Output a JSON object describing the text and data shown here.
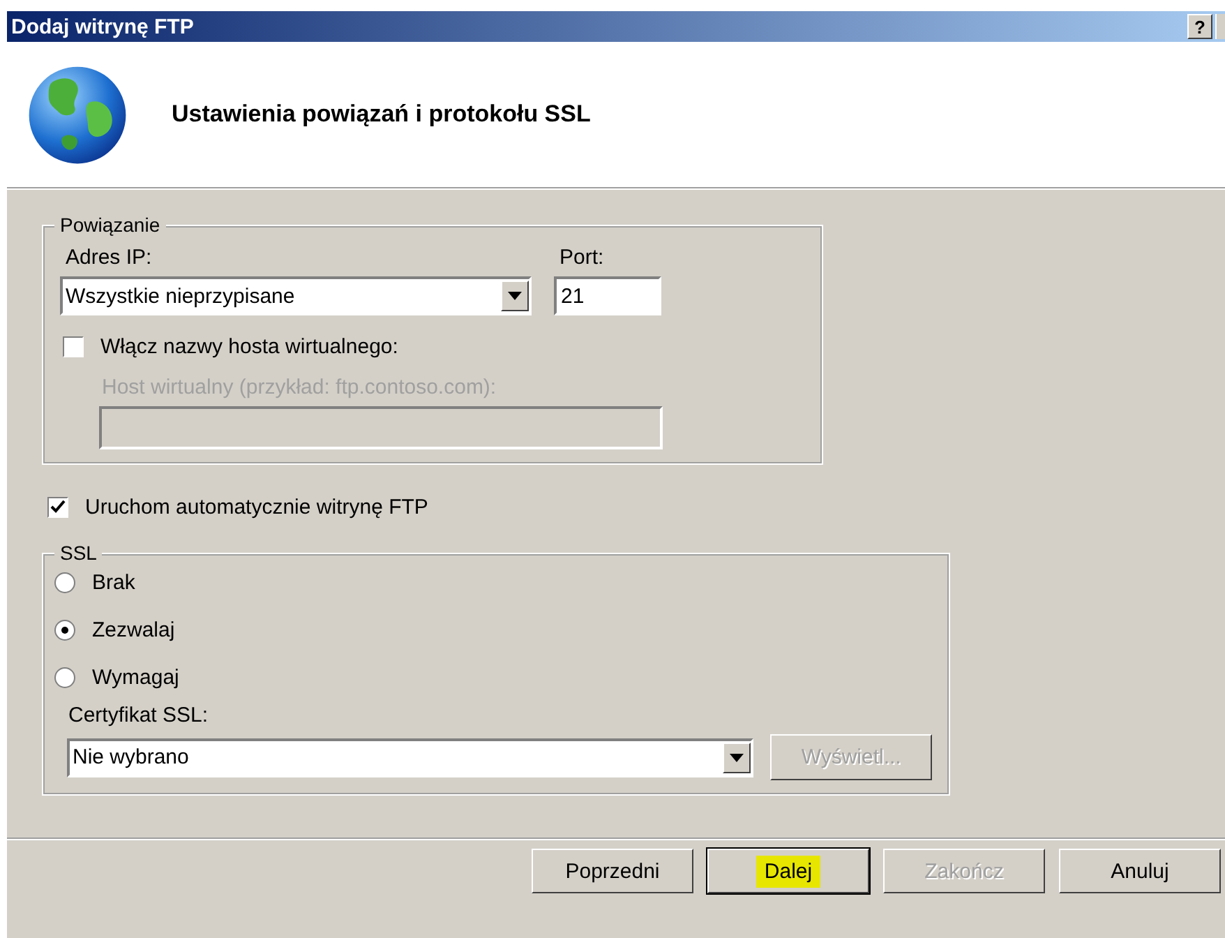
{
  "window": {
    "title": "Dodaj witrynę FTP",
    "help_button": "?"
  },
  "header": {
    "title": "Ustawienia powiązań i protokołu SSL"
  },
  "binding": {
    "legend": "Powiązanie",
    "ip_label": "Adres IP:",
    "ip_value": "Wszystkie nieprzypisane",
    "port_label": "Port:",
    "port_value": "21",
    "virtual_host": {
      "label": "Włącz nazwy hosta wirtualnego:",
      "checked": false
    },
    "host_label": "Host wirtualny (przykład: ftp.contoso.com):",
    "host_disabled": true
  },
  "autostart": {
    "label": "Uruchom automatycznie witrynę FTP",
    "checked": true
  },
  "ssl": {
    "legend": "SSL",
    "options": [
      {
        "label": "Brak",
        "selected": false
      },
      {
        "label": "Zezwalaj",
        "selected": true
      },
      {
        "label": "Wymagaj",
        "selected": false
      }
    ],
    "cert_label": "Certyfikat SSL:",
    "cert_value": "Nie wybrano",
    "view_button": {
      "label": "Wyświetl...",
      "disabled": true
    }
  },
  "buttons": [
    {
      "label": "Poprzedni",
      "disabled": false,
      "default": false,
      "highlighted": false
    },
    {
      "label": "Dalej",
      "disabled": false,
      "default": true,
      "highlighted": true
    },
    {
      "label": "Zakończ",
      "disabled": true,
      "default": false,
      "highlighted": false
    },
    {
      "label": "Anuluj",
      "disabled": false,
      "default": false,
      "highlighted": false
    }
  ]
}
